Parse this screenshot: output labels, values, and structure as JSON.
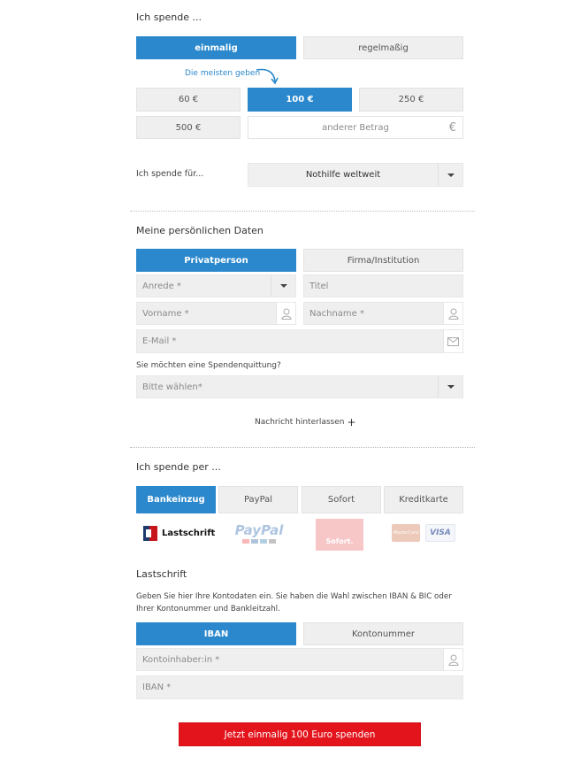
{
  "amount_section": {
    "heading": "Ich spende ...",
    "freq_once": "einmalig",
    "freq_regular": "regelmaßig",
    "hint": "Die meisten geben",
    "amounts": [
      "60 €",
      "100 €",
      "250 €",
      "500 €"
    ],
    "other_placeholder": "anderer Betrag",
    "currency_symbol": "€"
  },
  "purpose": {
    "label": "Ich spende für...",
    "selected": "Nothilfe weltweit"
  },
  "personal": {
    "heading": "Meine persönlichen Daten",
    "type_private": "Privatperson",
    "type_company": "Firma/Institution",
    "salutation_placeholder": "Anrede *",
    "title_placeholder": "Titel",
    "firstname_placeholder": "Vorname *",
    "lastname_placeholder": "Nachname *",
    "email_placeholder": "E-Mail *",
    "receipt_question": "Sie möchten eine Spendenquittung?",
    "receipt_placeholder": "Bitte wählen*",
    "message_link": "Nachricht hinterlassen",
    "message_plus": "+"
  },
  "payment": {
    "heading": "Ich spende per ...",
    "methods": [
      "Bankeinzug",
      "PayPal",
      "Sofort",
      "Kreditkarte"
    ],
    "logo_lastschrift": "Lastschrift",
    "logo_paypal": "PayPal",
    "logo_sofort": "Sofort.",
    "logo_mastercard": "MasterCard",
    "logo_visa": "VISA"
  },
  "debit": {
    "heading": "Lastschrift",
    "description": "Geben Sie hier Ihre Kontodaten ein. Sie haben die Wahl zwischen IBAN & BIC oder Ihrer Kontonummer und Bankleitzahl.",
    "tab_iban": "IBAN",
    "tab_account": "Kontonummer",
    "holder_placeholder": "Kontoinhaber:in *",
    "iban_placeholder": "IBAN *"
  },
  "submit": {
    "label": "Jetzt einmalig 100 Euro spenden"
  },
  "colors": {
    "accent": "#2b88cc",
    "submit": "#e3141c",
    "field": "#efefef"
  }
}
